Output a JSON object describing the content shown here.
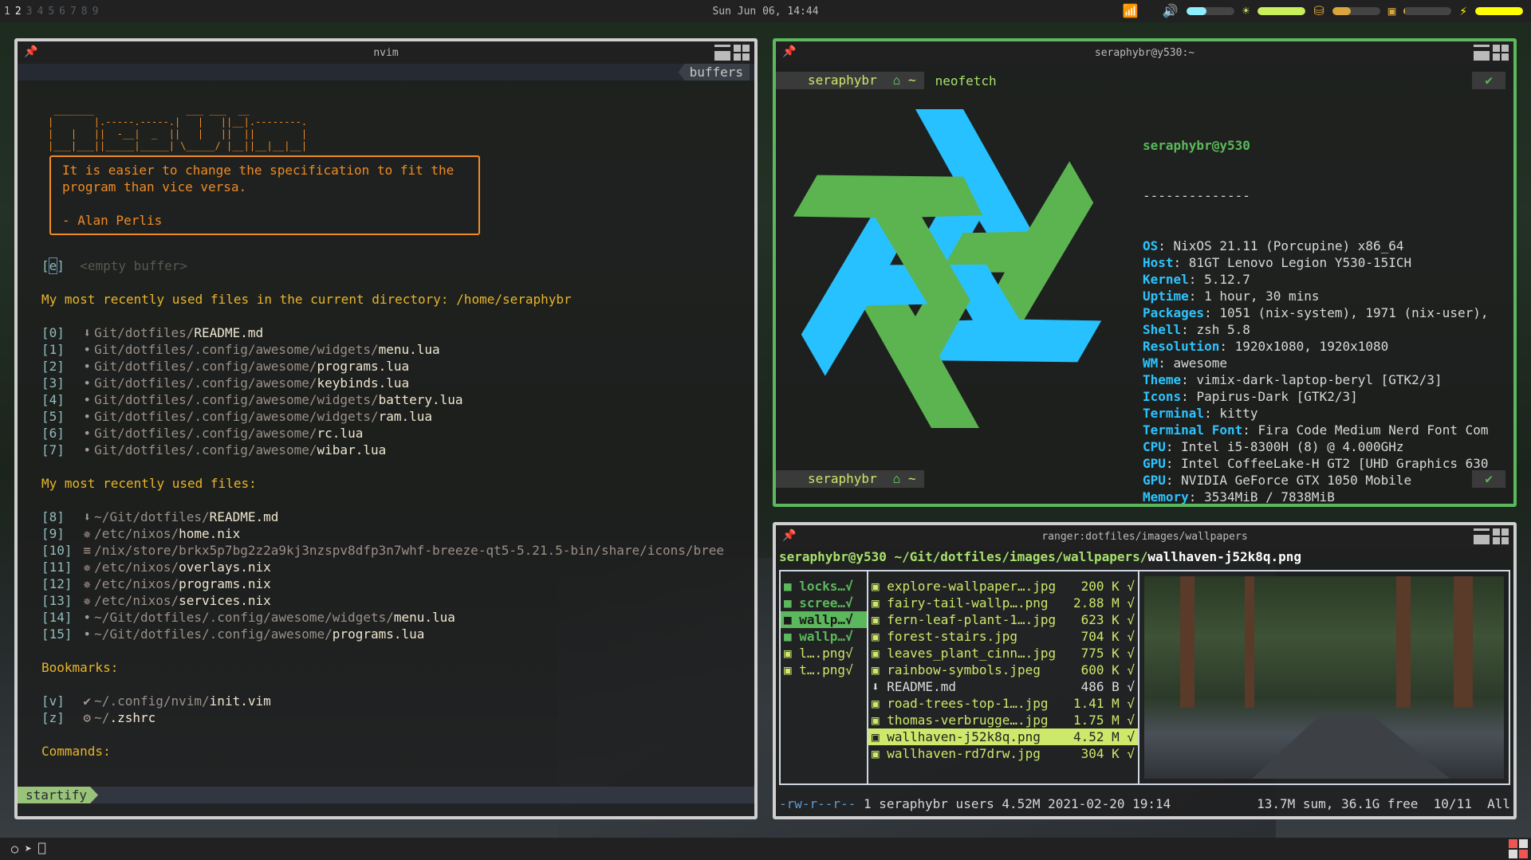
{
  "topbar": {
    "tags": [
      "1",
      "2",
      "3",
      "4",
      "5",
      "6",
      "7",
      "8",
      "9"
    ],
    "active_tag": "2",
    "occupied_tags": [
      "1",
      "2"
    ],
    "clock": "Sun Jun 06, 14:44",
    "tray": {
      "wifi_icon": "wifi-icon",
      "volume_icon": "volume-icon",
      "volume_level": 0.42,
      "volume_color": "#8ef0ff",
      "brightness_icon": "brightness-icon",
      "brightness_level": 1.0,
      "brightness_color": "#c9f05a",
      "disk_icon": "disk-icon",
      "disk_level": 0.38,
      "disk_color": "#d9a53c",
      "cpu_icon": "cpu-icon",
      "cpu_level": 0.03,
      "cpu_color": "#d9a53c",
      "battery_icon": "battery-charging-icon",
      "battery_level": 1.0,
      "battery_color": "#ffff00"
    }
  },
  "nvim": {
    "title": "nvim",
    "tabline_label": "buffers",
    "ascii_art": " _______                ___ ___  __\n|       |.-----.-----.|   |   ||__|.--------.\n|   |   ||  -__|  _  ||   |   ||  ||        |\n|___|___||_____|_____| \\_____/ |__||__|__|__|",
    "quote": "It is easier to change the specification to fit the\nprogram than vice versa.\n\n- Alan Perlis",
    "empty_buffer": {
      "key": "e",
      "label": "<empty buffer>"
    },
    "section_cwd": "My most recently used files in the current directory: /home/seraphybr",
    "cwd_files": [
      {
        "idx": "[0]",
        "icon": "markdown-icon",
        "glyph": "⬇",
        "path": "Git/dotfiles/",
        "name": "README.md"
      },
      {
        "idx": "[1]",
        "icon": "lua-icon",
        "glyph": "•",
        "path": "Git/dotfiles/.config/awesome/widgets/",
        "name": "menu.lua"
      },
      {
        "idx": "[2]",
        "icon": "lua-icon",
        "glyph": "•",
        "path": "Git/dotfiles/.config/awesome/",
        "name": "programs.lua"
      },
      {
        "idx": "[3]",
        "icon": "lua-icon",
        "glyph": "•",
        "path": "Git/dotfiles/.config/awesome/",
        "name": "keybinds.lua"
      },
      {
        "idx": "[4]",
        "icon": "lua-icon",
        "glyph": "•",
        "path": "Git/dotfiles/.config/awesome/widgets/",
        "name": "battery.lua"
      },
      {
        "idx": "[5]",
        "icon": "lua-icon",
        "glyph": "•",
        "path": "Git/dotfiles/.config/awesome/widgets/",
        "name": "ram.lua"
      },
      {
        "idx": "[6]",
        "icon": "lua-icon",
        "glyph": "•",
        "path": "Git/dotfiles/.config/awesome/",
        "name": "rc.lua"
      },
      {
        "idx": "[7]",
        "icon": "lua-icon",
        "glyph": "•",
        "path": "Git/dotfiles/.config/awesome/",
        "name": "wibar.lua"
      }
    ],
    "section_recent": "My most recently used files:",
    "recent_files": [
      {
        "idx": "[8]",
        "icon": "markdown-icon",
        "glyph": "⬇",
        "path": "~/Git/dotfiles/",
        "name": "README.md"
      },
      {
        "idx": "[9]",
        "icon": "nix-icon",
        "glyph": "✵",
        "path": "/etc/nixos/",
        "name": "home.nix"
      },
      {
        "idx": "[10]",
        "icon": "text-icon",
        "glyph": "≡",
        "path": "/nix/store/brkx5p7bg2z2a9kj3nzspv8dfp3n7whf-breeze-qt5-5.21.5-bin/share/icons/bree",
        "name": ""
      },
      {
        "idx": "[11]",
        "icon": "nix-icon",
        "glyph": "✵",
        "path": "/etc/nixos/",
        "name": "overlays.nix"
      },
      {
        "idx": "[12]",
        "icon": "nix-icon",
        "glyph": "✵",
        "path": "/etc/nixos/",
        "name": "programs.nix"
      },
      {
        "idx": "[13]",
        "icon": "nix-icon",
        "glyph": "✵",
        "path": "/etc/nixos/",
        "name": "services.nix"
      },
      {
        "idx": "[14]",
        "icon": "lua-icon",
        "glyph": "•",
        "path": "~/Git/dotfiles/.config/awesome/widgets/",
        "name": "menu.lua"
      },
      {
        "idx": "[15]",
        "icon": "lua-icon",
        "glyph": "•",
        "path": "~/Git/dotfiles/.config/awesome/",
        "name": "programs.lua"
      }
    ],
    "section_bookmarks": "Bookmarks:",
    "bookmarks": [
      {
        "idx": "[v]",
        "icon": "vim-icon",
        "glyph": "✔",
        "path": "~/.config/nvim/",
        "name": "init.vim"
      },
      {
        "idx": "[z]",
        "icon": "gear-icon",
        "glyph": "⚙",
        "path": "~/",
        "name": ".zshrc"
      }
    ],
    "section_commands": "Commands:",
    "mode": "startify"
  },
  "kitty": {
    "title": "seraphybr@y530:~",
    "prompt_user": "seraphybr",
    "prompt_dir": "~",
    "command": "neofetch",
    "ok_mark": "✔",
    "user_host": "seraphybr@y530",
    "separator": "--------------",
    "info": [
      {
        "k": "OS",
        "v": "NixOS 21.11 (Porcupine) x86_64"
      },
      {
        "k": "Host",
        "v": "81GT Lenovo Legion Y530-15ICH"
      },
      {
        "k": "Kernel",
        "v": "5.12.7"
      },
      {
        "k": "Uptime",
        "v": "1 hour, 30 mins"
      },
      {
        "k": "Packages",
        "v": "1051 (nix-system), 1971 (nix-user),"
      },
      {
        "k": "Shell",
        "v": "zsh 5.8"
      },
      {
        "k": "Resolution",
        "v": "1920x1080, 1920x1080"
      },
      {
        "k": "WM",
        "v": "awesome"
      },
      {
        "k": "Theme",
        "v": "vimix-dark-laptop-beryl [GTK2/3]"
      },
      {
        "k": "Icons",
        "v": "Papirus-Dark [GTK2/3]"
      },
      {
        "k": "Terminal",
        "v": "kitty"
      },
      {
        "k": "Terminal Font",
        "v": "Fira Code Medium Nerd Font Com"
      },
      {
        "k": "CPU",
        "v": "Intel i5-8300H (8) @ 4.000GHz"
      },
      {
        "k": "GPU",
        "v": "Intel CoffeeLake-H GT2 [UHD Graphics 630"
      },
      {
        "k": "GPU",
        "v": "NVIDIA GeForce GTX 1050 Mobile"
      },
      {
        "k": "Memory",
        "v": "3534MiB / 7838MiB"
      }
    ],
    "palette": [
      "#4a4a4a",
      "#ff6a6a",
      "#a5e04a",
      "#d9ef74",
      "#5cb85c",
      "#b37ee8",
      "#2cc4ff",
      "#f0f0f0",
      "#6584ab",
      "#f5546e",
      "#4ed8ea",
      "#d9ef74",
      "#5cb85c",
      "#b37ee8",
      "#2cc4ff",
      "#ffffff"
    ],
    "logo_colors": {
      "blue": "#27c1ff",
      "green": "#5cb450"
    }
  },
  "ranger": {
    "title": "ranger:dotfiles/images/wallpapers",
    "user_host": "seraphybr@y530",
    "path": " ~/Git/dotfiles/images/wallpapers/",
    "current_file": "wallhaven-j52k8q.png",
    "parent_entries": [
      {
        "name": "locks…√",
        "type": "dir",
        "selected": false
      },
      {
        "name": "scree…√",
        "type": "dir",
        "selected": false
      },
      {
        "name": "wallp…√",
        "type": "dir",
        "selected": true
      },
      {
        "name": "wallp…√",
        "type": "dir",
        "selected": false
      },
      {
        "name": "l….png√",
        "type": "image",
        "selected": false
      },
      {
        "name": "t….png√",
        "type": "image",
        "selected": false
      }
    ],
    "files": [
      {
        "name": "explore-wallpaper….jpg",
        "size": "200 K",
        "type": "image",
        "selected": false
      },
      {
        "name": "fairy-tail-wallp….png",
        "size": "2.88 M",
        "type": "image",
        "selected": false
      },
      {
        "name": "fern-leaf-plant-1….jpg",
        "size": "623 K",
        "type": "image",
        "selected": false
      },
      {
        "name": "forest-stairs.jpg",
        "size": "704 K",
        "type": "image",
        "selected": false
      },
      {
        "name": "leaves_plant_cinn….jpg",
        "size": "775 K",
        "type": "image",
        "selected": false
      },
      {
        "name": "rainbow-symbols.jpeg",
        "size": "600 K",
        "type": "image",
        "selected": false
      },
      {
        "name": "README.md",
        "size": "486 B",
        "type": "markdown",
        "selected": false
      },
      {
        "name": "road-trees-top-1….jpg",
        "size": "1.41 M",
        "type": "image",
        "selected": false
      },
      {
        "name": "thomas-verbrugge….jpg",
        "size": "1.75 M",
        "type": "image",
        "selected": false
      },
      {
        "name": "wallhaven-j52k8q.png",
        "size": "4.52 M",
        "type": "image",
        "selected": true
      },
      {
        "name": "wallhaven-rd7drw.jpg",
        "size": "304 K",
        "type": "image",
        "selected": false
      }
    ],
    "check_mark": "√",
    "status": {
      "perms": "-rw-r--r--",
      "info": " 1 seraphybr users 4.52M 2021-02-20 19:14",
      "summary": "13.7M sum, 36.1G free  10/11  All"
    }
  },
  "bottombar": {
    "launchers": [
      {
        "icon": "lightbulb-icon",
        "glyph": "○"
      },
      {
        "icon": "telegram-icon",
        "glyph": "➤"
      },
      {
        "icon": "usb-icon",
        "glyph": "⎕"
      }
    ],
    "layout_icon": "tile-layout-icon"
  }
}
